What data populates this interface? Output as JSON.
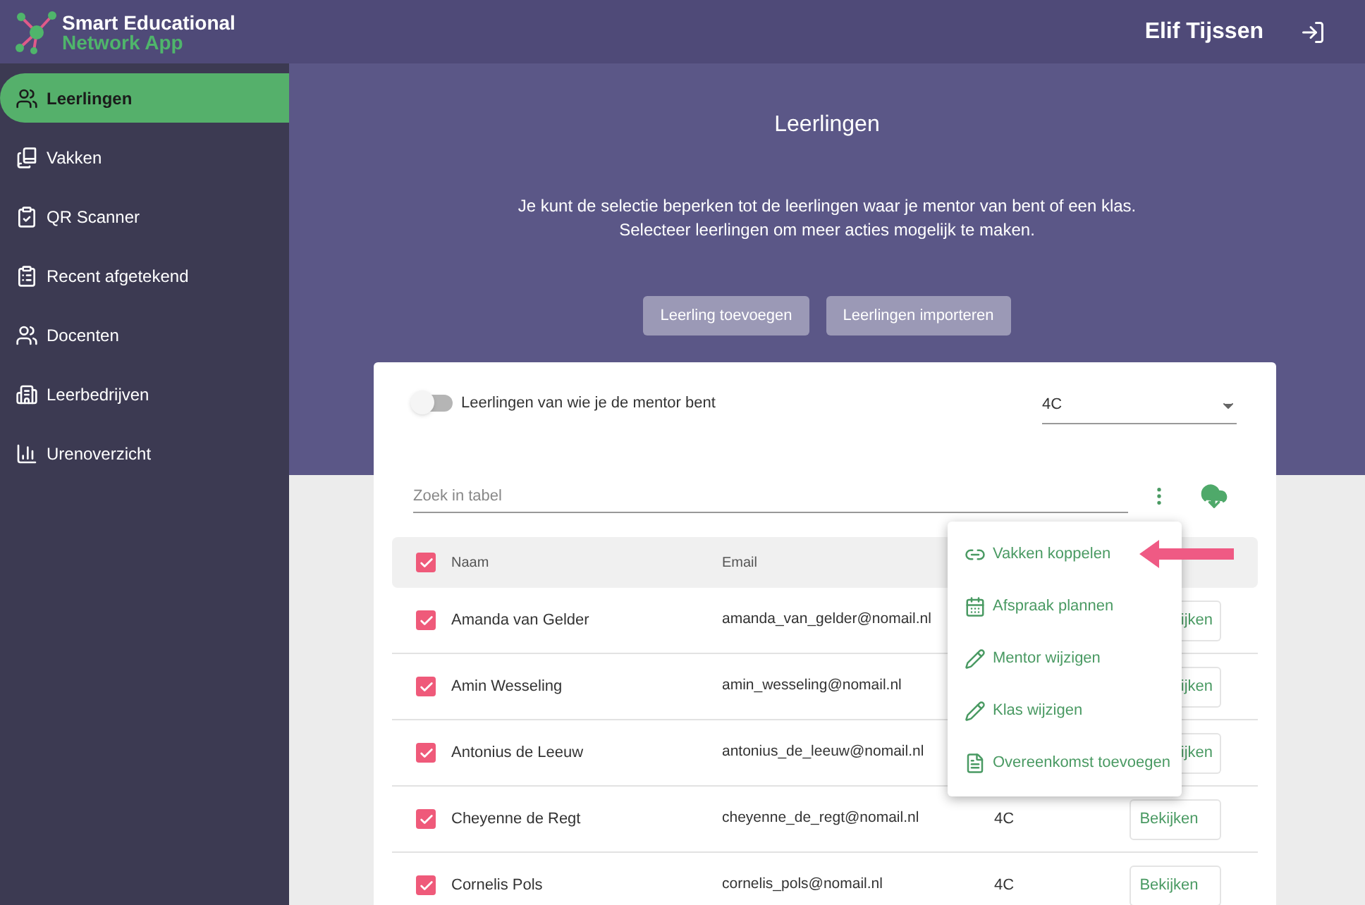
{
  "app": {
    "logo_line1": "Smart Educational",
    "logo_line2": "Network App"
  },
  "user": {
    "name": "Elif Tijssen"
  },
  "sidebar": {
    "items": [
      {
        "label": "Leerlingen",
        "kind": "people",
        "selected": true
      },
      {
        "label": "Vakken",
        "kind": "books",
        "selected": false
      },
      {
        "label": "QR Scanner",
        "kind": "check",
        "selected": false
      },
      {
        "label": "Recent afgetekend",
        "kind": "clipboard",
        "selected": false
      },
      {
        "label": "Docenten",
        "kind": "people",
        "selected": false
      },
      {
        "label": "Leerbedrijven",
        "kind": "building",
        "selected": false
      },
      {
        "label": "Urenoverzicht",
        "kind": "chart",
        "selected": false
      }
    ]
  },
  "page": {
    "title": "Leerlingen",
    "description": [
      "Je kunt de selectie beperken tot de leerlingen waar je mentor van bent of een klas.",
      "Selecteer leerlingen om meer acties mogelijk te maken."
    ],
    "buttons": [
      "Leerling toevoegen",
      "Leerlingen importeren"
    ]
  },
  "filter": {
    "mentor_toggle": {
      "label": "Leerlingen van wie je de mentor bent",
      "on": false
    },
    "class_select": {
      "value": "4C"
    }
  },
  "search": {
    "placeholder": "Zoek in tabel"
  },
  "table": {
    "select_all": {
      "checked": true
    },
    "columns": [
      "Naam",
      "Email"
    ],
    "rows": [
      {
        "checked": true,
        "name": "Amanda van Gelder",
        "email": "amanda_van_gelder@nomail.nl",
        "action": "ijken",
        "cut_off": true
      },
      {
        "checked": true,
        "name": "Amin Wesseling",
        "email": "amin_wesseling@nomail.nl",
        "action": "ijken",
        "cut_off": true
      },
      {
        "checked": true,
        "name": "Antonius de Leeuw",
        "email": "antonius_de_leeuw@nomail.nl",
        "action": "ijken",
        "cut_off": true
      },
      {
        "checked": true,
        "name": "Cheyenne de Regt",
        "email": "cheyenne_de_regt@nomail.nl",
        "class": "4C",
        "action": "Bekijken",
        "cut_off": false
      },
      {
        "checked": true,
        "name": "Cornelis Pols",
        "email": "cornelis_pols@nomail.nl",
        "class": "4C",
        "action": "Bekijken",
        "cut_off": false
      }
    ]
  },
  "menu": {
    "items": [
      {
        "label": "Vakken koppelen",
        "kind": "link"
      },
      {
        "label": "Afspraak plannen",
        "kind": "calendar"
      },
      {
        "label": "Mentor wijzigen",
        "kind": "pencil"
      },
      {
        "label": "Klas wijzigen",
        "kind": "pencil"
      },
      {
        "label": "Overeenkomst toevoegen",
        "kind": "file"
      }
    ]
  }
}
